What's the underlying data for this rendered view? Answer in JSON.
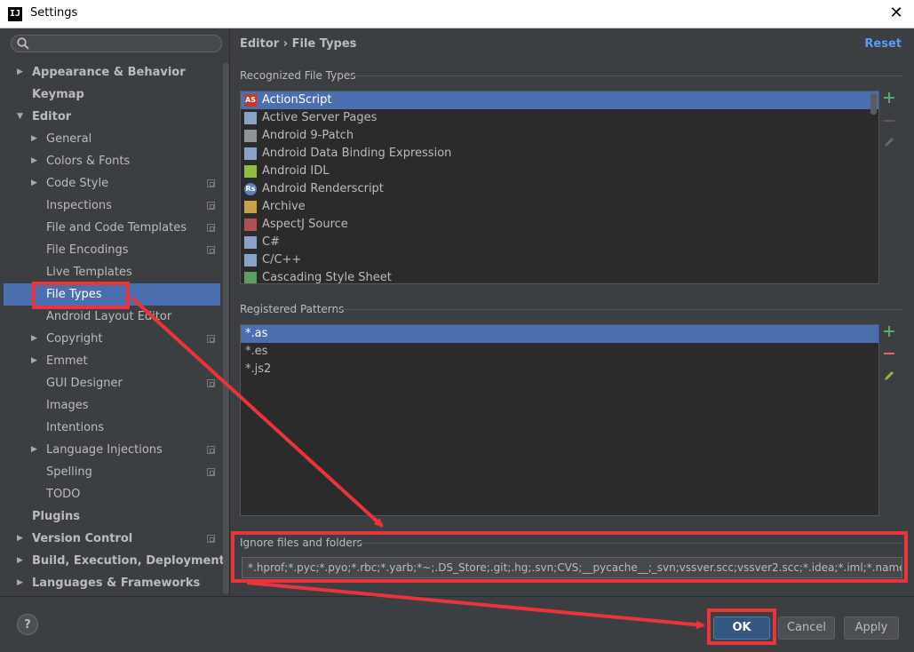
{
  "window": {
    "title": "Settings",
    "app_icon_text": "IJ"
  },
  "sidebar": {
    "search_placeholder": "",
    "items": [
      {
        "label": "Appearance & Behavior",
        "bold": true,
        "level": 0,
        "arrow": "collapsed",
        "project": false
      },
      {
        "label": "Keymap",
        "bold": true,
        "level": 0,
        "arrow": "none",
        "project": false
      },
      {
        "label": "Editor",
        "bold": true,
        "level": 0,
        "arrow": "expanded",
        "project": false
      },
      {
        "label": "General",
        "level": 1,
        "arrow": "collapsed",
        "project": false
      },
      {
        "label": "Colors & Fonts",
        "level": 1,
        "arrow": "collapsed",
        "project": false
      },
      {
        "label": "Code Style",
        "level": 1,
        "arrow": "collapsed",
        "project": true
      },
      {
        "label": "Inspections",
        "level": 1,
        "arrow": "none",
        "project": true
      },
      {
        "label": "File and Code Templates",
        "level": 1,
        "arrow": "none",
        "project": true
      },
      {
        "label": "File Encodings",
        "level": 1,
        "arrow": "none",
        "project": true
      },
      {
        "label": "Live Templates",
        "level": 1,
        "arrow": "none",
        "project": false
      },
      {
        "label": "File Types",
        "level": 1,
        "arrow": "none",
        "project": false,
        "selected": true
      },
      {
        "label": "Android Layout Editor",
        "level": 1,
        "arrow": "none",
        "project": false
      },
      {
        "label": "Copyright",
        "level": 1,
        "arrow": "collapsed",
        "project": true
      },
      {
        "label": "Emmet",
        "level": 1,
        "arrow": "collapsed",
        "project": false
      },
      {
        "label": "GUI Designer",
        "level": 1,
        "arrow": "none",
        "project": true
      },
      {
        "label": "Images",
        "level": 1,
        "arrow": "none",
        "project": false
      },
      {
        "label": "Intentions",
        "level": 1,
        "arrow": "none",
        "project": false
      },
      {
        "label": "Language Injections",
        "level": 1,
        "arrow": "collapsed",
        "project": true
      },
      {
        "label": "Spelling",
        "level": 1,
        "arrow": "none",
        "project": true
      },
      {
        "label": "TODO",
        "level": 1,
        "arrow": "none",
        "project": false
      },
      {
        "label": "Plugins",
        "bold": true,
        "level": 0,
        "arrow": "none",
        "project": false
      },
      {
        "label": "Version Control",
        "bold": true,
        "level": 0,
        "arrow": "collapsed",
        "project": true
      },
      {
        "label": "Build, Execution, Deployment",
        "bold": true,
        "level": 0,
        "arrow": "collapsed",
        "project": false
      },
      {
        "label": "Languages & Frameworks",
        "bold": true,
        "level": 0,
        "arrow": "collapsed",
        "project": false
      }
    ]
  },
  "content": {
    "breadcrumb": "Editor › File Types",
    "reset_label": "Reset",
    "recognized_title": "Recognized File Types",
    "file_types": [
      {
        "label": "ActionScript",
        "icon": "actionscript-icon",
        "icon_text": "AS",
        "icon_color": "#c0392b",
        "selected": true
      },
      {
        "label": "Active Server Pages",
        "icon": "asp-file-icon",
        "icon_text": "",
        "icon_color": "#8aa4c8"
      },
      {
        "label": "Android 9-Patch",
        "icon": "folder-icon",
        "icon_text": "",
        "icon_color": "#8f9599"
      },
      {
        "label": "Android Data Binding Expression",
        "icon": "android-file-icon",
        "icon_text": "",
        "icon_color": "#8aa4c8"
      },
      {
        "label": "Android IDL",
        "icon": "android-robot-icon",
        "icon_text": "",
        "icon_color": "#8fbf3f"
      },
      {
        "label": "Android Renderscript",
        "icon": "renderscript-icon",
        "icon_text": "Rs",
        "icon_color": "#5d7fb8"
      },
      {
        "label": "Archive",
        "icon": "archive-icon",
        "icon_text": "",
        "icon_color": "#c8a24a"
      },
      {
        "label": "AspectJ Source",
        "icon": "aspectj-icon",
        "icon_text": "",
        "icon_color": "#b05050"
      },
      {
        "label": "C#",
        "icon": "csharp-file-icon",
        "icon_text": "",
        "icon_color": "#8aa4c8"
      },
      {
        "label": "C/C++",
        "icon": "cpp-file-icon",
        "icon_text": "",
        "icon_color": "#8aa4c8"
      },
      {
        "label": "Cascading Style Sheet",
        "icon": "css-file-icon",
        "icon_text": "",
        "icon_color": "#5aa05a"
      }
    ],
    "patterns_title": "Registered Patterns",
    "patterns": [
      {
        "label": "*.as",
        "selected": true
      },
      {
        "label": "*.es"
      },
      {
        "label": "*.js2"
      }
    ],
    "ignore_title": "Ignore files and folders",
    "ignore_value": "*.hprof;*.pyc;*.pyo;*.rbc;*.yarb;*~;.DS_Store;.git;.hg;.svn;CVS;__pycache__;_svn;vssver.scc;vssver2.scc;*.idea;*.iml;*.name;"
  },
  "buttons": {
    "help": "?",
    "ok": "OK",
    "cancel": "Cancel",
    "apply": "Apply"
  },
  "colors": {
    "accent": "#4b6eaf",
    "annotation": "#e8343a",
    "add": "#59a869",
    "remove": "#e06b5b",
    "edit": "#8fbf3f"
  }
}
